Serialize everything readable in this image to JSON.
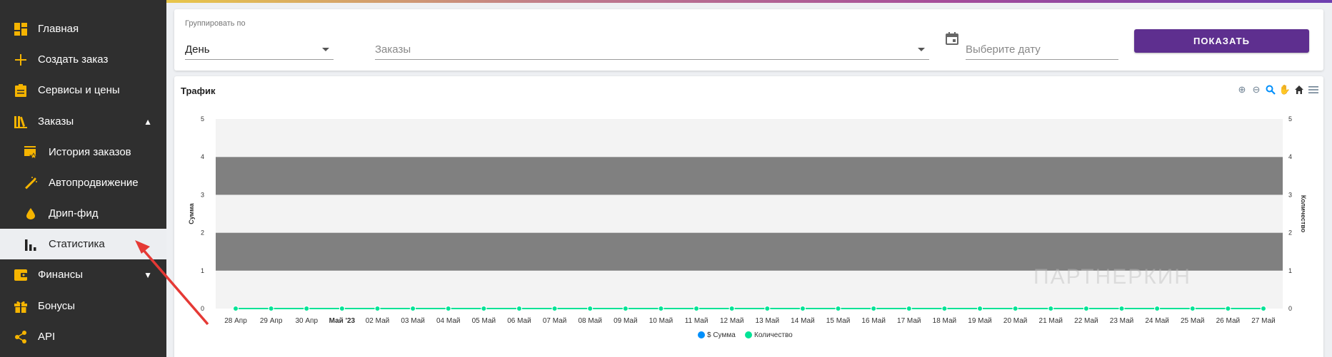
{
  "sidebar": {
    "items": [
      {
        "label": "Главная",
        "icon": "dashboard-icon"
      },
      {
        "label": "Создать заказ",
        "icon": "plus-icon"
      },
      {
        "label": "Сервисы и цены",
        "icon": "clipboard-icon"
      },
      {
        "label": "Заказы",
        "icon": "books-icon",
        "expanded": true
      },
      {
        "label": "История заказов",
        "icon": "order-history-icon"
      },
      {
        "label": "Автопродвижение",
        "icon": "magic-wand-icon"
      },
      {
        "label": "Дрип-фид",
        "icon": "drop-icon"
      },
      {
        "label": "Статистика",
        "icon": "bar-chart-icon",
        "active": true
      },
      {
        "label": "Финансы",
        "icon": "wallet-icon",
        "expanded": false
      },
      {
        "label": "Бонусы",
        "icon": "gift-icon"
      },
      {
        "label": "API",
        "icon": "share-icon"
      }
    ]
  },
  "filters": {
    "group_by_label": "Группировать по",
    "group_by_value": "День",
    "orders_placeholder": "Заказы",
    "date_placeholder": "Выберите дату",
    "show_button": "ПОКАЗАТЬ"
  },
  "chart": {
    "title": "Трафик",
    "watermark": "ПАРТНЕРКИН"
  },
  "colors": {
    "accent": "#5e2f8f",
    "sidebar_bg": "#2f2f2f",
    "icon_yellow": "#f5b400",
    "series_sum": "#008ffb",
    "series_count": "#00e396"
  },
  "chart_data": {
    "type": "line",
    "title": "Трафик",
    "xlabel": "",
    "ylabel": "Сумма",
    "ylabel_right": "Количество",
    "ylim": [
      0,
      5
    ],
    "yticks": [
      0,
      1,
      2,
      3,
      4,
      5
    ],
    "grid": true,
    "legend": "bottom",
    "categories": [
      "28 Апр",
      "29 Апр",
      "30 Апр",
      "Май '23",
      "02 Май",
      "03 Май",
      "04 Май",
      "05 Май",
      "06 Май",
      "07 Май",
      "08 Май",
      "09 Май",
      "10 Май",
      "11 Май",
      "12 Май",
      "13 Май",
      "14 Май",
      "15 Май",
      "16 Май",
      "17 Май",
      "18 Май",
      "19 Май",
      "20 Май",
      "21 Май",
      "22 Май",
      "23 Май",
      "24 Май",
      "25 Май",
      "26 Май",
      "27 Май"
    ],
    "series": [
      {
        "name": "$ Сумма",
        "values": [
          0,
          0,
          0,
          0,
          0,
          0,
          0,
          0,
          0,
          0,
          0,
          0,
          0,
          0,
          0,
          0,
          0,
          0,
          0,
          0,
          0,
          0,
          0,
          0,
          0,
          0,
          0,
          0,
          0,
          0
        ]
      },
      {
        "name": "Количество",
        "values": [
          0,
          0,
          0,
          0,
          0,
          0,
          0,
          0,
          0,
          0,
          0,
          0,
          0,
          0,
          0,
          0,
          0,
          0,
          0,
          0,
          0,
          0,
          0,
          0,
          0,
          0,
          0,
          0,
          0,
          0
        ]
      }
    ]
  }
}
